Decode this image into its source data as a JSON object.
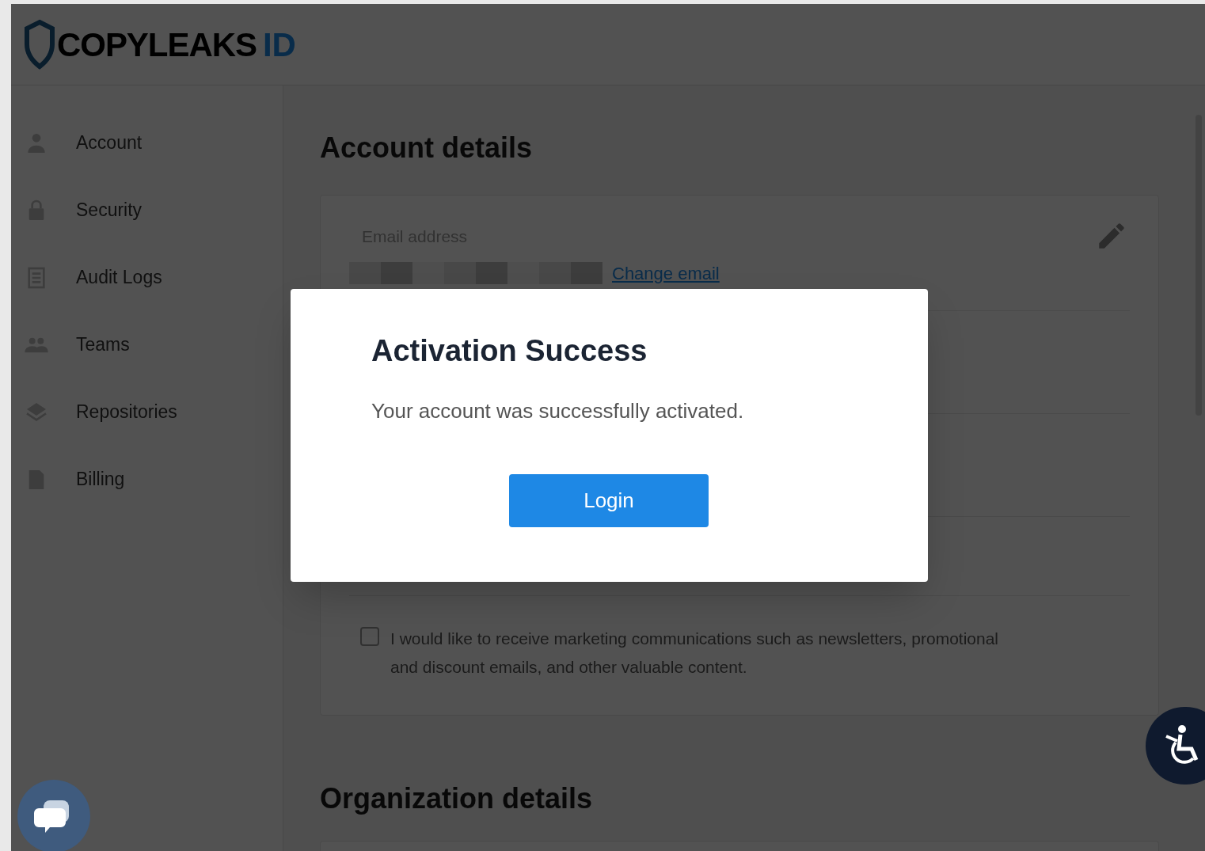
{
  "header": {
    "logo_text": "COPYLEAKS",
    "logo_suffix": "ID"
  },
  "sidebar": {
    "items": [
      {
        "label": "Account"
      },
      {
        "label": "Security"
      },
      {
        "label": "Audit Logs"
      },
      {
        "label": "Teams"
      },
      {
        "label": "Repositories"
      },
      {
        "label": "Billing"
      }
    ]
  },
  "account_details": {
    "title": "Account details",
    "email_label": "Email address",
    "change_email_link": "Change email",
    "marketing_checkbox": {
      "label": "I would like to receive marketing communications such as newsletters, promotional and discount emails, and other valuable content.",
      "checked": false
    }
  },
  "organization_details": {
    "title": "Organization details"
  },
  "dialog": {
    "title": "Activation Success",
    "message": "Your account was successfully activated.",
    "button": "Login"
  }
}
